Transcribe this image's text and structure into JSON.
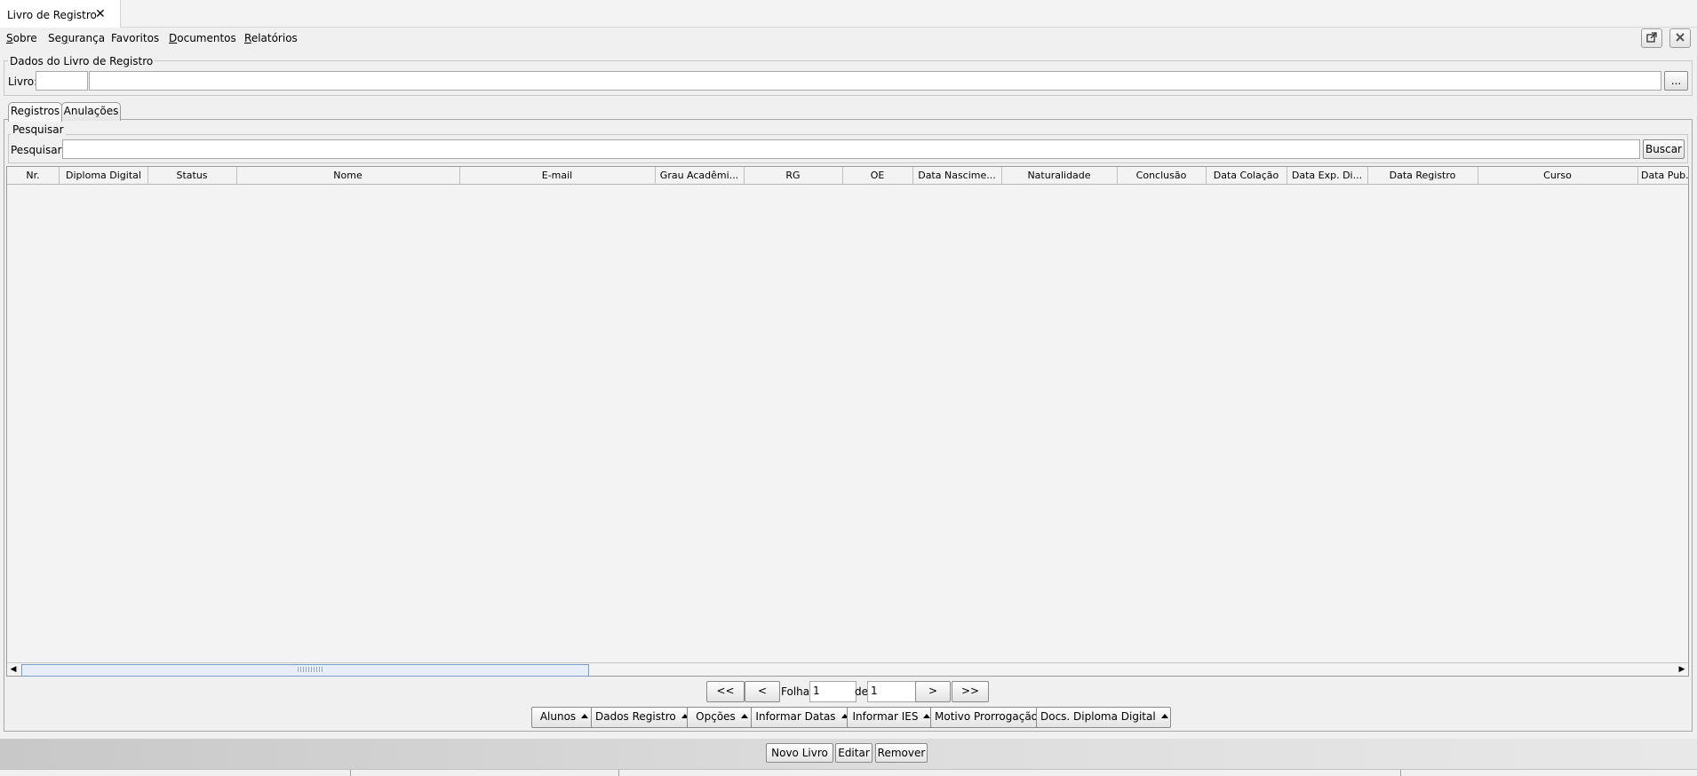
{
  "window": {
    "tab_title": "Livro de Registro",
    "close_glyph": "✕"
  },
  "menu": [
    {
      "label": "Sobre",
      "mnemonic": "S"
    },
    {
      "label": "Segurança",
      "mnemonic": "g"
    },
    {
      "label": "Favoritos",
      "mnemonic": ""
    },
    {
      "label": "Documentos",
      "mnemonic": "D"
    },
    {
      "label": "Relatórios",
      "mnemonic": "R"
    }
  ],
  "window_controls": {
    "detach_icon": "external-window-icon",
    "close_icon": "close-icon"
  },
  "livro_group": {
    "title": "Dados do Livro de Registro",
    "livro_label": "Livro:",
    "livro_code": "",
    "livro_name": "",
    "browse_label": "..."
  },
  "tabs": [
    {
      "label": "Registros",
      "active": true
    },
    {
      "label": "Anulações",
      "active": false
    }
  ],
  "search": {
    "group_title": "Pesquisar",
    "label": "Pesquisar:",
    "value": "",
    "button": "Buscar"
  },
  "table": {
    "columns": [
      "Nr.",
      "Diploma Digital",
      "Status",
      "Nome",
      "E-mail",
      "Grau Acadêmi...",
      "RG",
      "OE",
      "Data Nascime...",
      "Naturalidade",
      "Conclusão",
      "Data Colação",
      "Data Exp. Di...",
      "Data Registro",
      "Curso",
      "Data Pub. R"
    ],
    "rows": []
  },
  "pagination": {
    "first": "<<",
    "prev": "<",
    "page_label": "Folha",
    "page": "1",
    "of_label": "de",
    "total": "1",
    "next": ">",
    "last": ">>"
  },
  "actions": [
    "Alunos",
    "Dados Registro",
    "Opções",
    "Informar Datas",
    "Informar IES",
    "Motivo Prorrogação",
    "Docs. Diploma Digital"
  ],
  "footer_buttons": {
    "new": "Novo Livro",
    "edit": "Editar",
    "remove": "Remover"
  }
}
